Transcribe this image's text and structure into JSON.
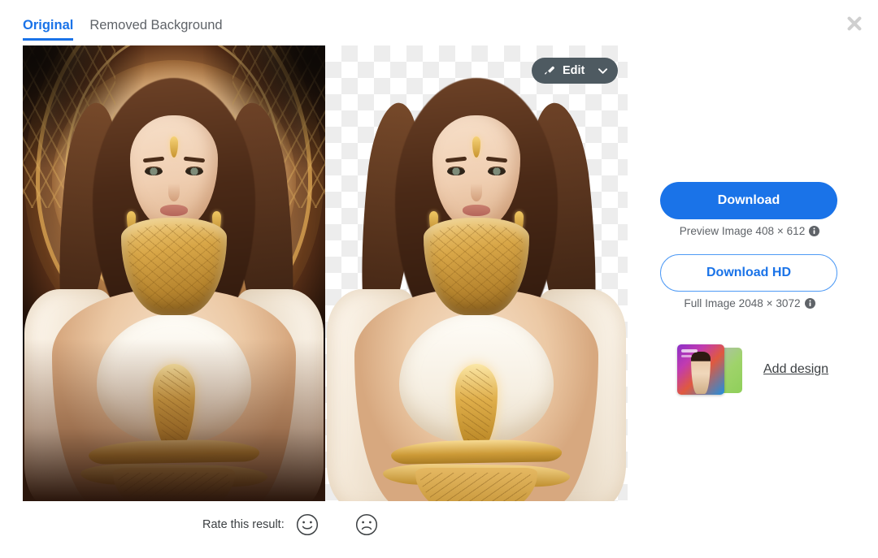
{
  "tabs": [
    {
      "label": "Original",
      "active": true
    },
    {
      "label": "Removed Background",
      "active": false
    }
  ],
  "close_icon": "close-icon",
  "viewer": {
    "original_pane_name": "original-image",
    "removed_pane_name": "removed-background-image",
    "edit_button": {
      "label": "Edit",
      "icon": "brush-icon",
      "dropdown_icon": "chevron-down-icon"
    }
  },
  "rate": {
    "label": "Rate this result:",
    "positive_icon": "smiley-face-icon",
    "negative_icon": "frowny-face-icon"
  },
  "sidebar": {
    "download": {
      "label": "Download",
      "caption": "Preview Image 408 × 612",
      "info_icon": "info-icon"
    },
    "download_hd": {
      "label": "Download HD",
      "caption": "Full Image 2048 × 3072",
      "info_icon": "info-icon"
    },
    "add_design": {
      "label": "Add design",
      "thumbnail_icon": "design-stack-thumbnail"
    }
  },
  "colors": {
    "accent_blue": "#1a73e8",
    "outline_blue": "#4e9af5",
    "text_gray": "#5f6368",
    "edit_button_bg": "#4e5a61",
    "close_gray": "#cfcfcf"
  }
}
